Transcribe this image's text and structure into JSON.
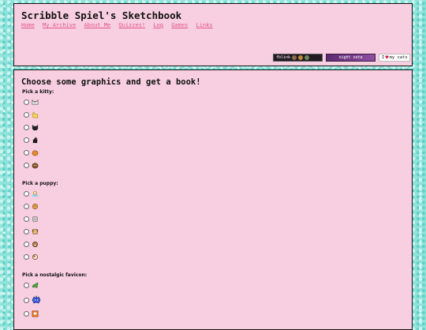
{
  "site": {
    "title": "Scribble Spiel's Sketchbook",
    "nav": [
      "Home",
      "My Archive",
      "About Me",
      "Quizzes!",
      "Log",
      "Games",
      "Links"
    ]
  },
  "badges": [
    {
      "name": "fblink-button",
      "text": "fblink"
    },
    {
      "name": "night-vote-button",
      "text": "night vote"
    },
    {
      "name": "i-love-my-cats-button",
      "text_before": "I",
      "text_after": "my cats"
    }
  ],
  "main": {
    "title": "Choose some graphics and get a book!",
    "groups": [
      {
        "label": "Pick a kitty:",
        "icons": [
          "white-cat-icon",
          "yellow-cat-icon",
          "black-cat-icon",
          "black-cat-side-icon",
          "orange-cat-icon",
          "brown-cat-icon"
        ]
      },
      {
        "label": "Pick a puppy:",
        "icons": [
          "puppy-blue-icon",
          "orange-puppy-icon",
          "gray-puppy-icon",
          "tan-puppy-icon",
          "brown-puppy-icon",
          "spotted-puppy-icon"
        ]
      },
      {
        "label": "Pick a nostalgic favicon:",
        "icons": [
          "green-dino-icon",
          "blue-monster-icon",
          "orange-face-icon"
        ]
      }
    ]
  },
  "colors": {
    "panel": "#f8cfe0",
    "link": "#e0568b",
    "background": "#8fe3db"
  }
}
